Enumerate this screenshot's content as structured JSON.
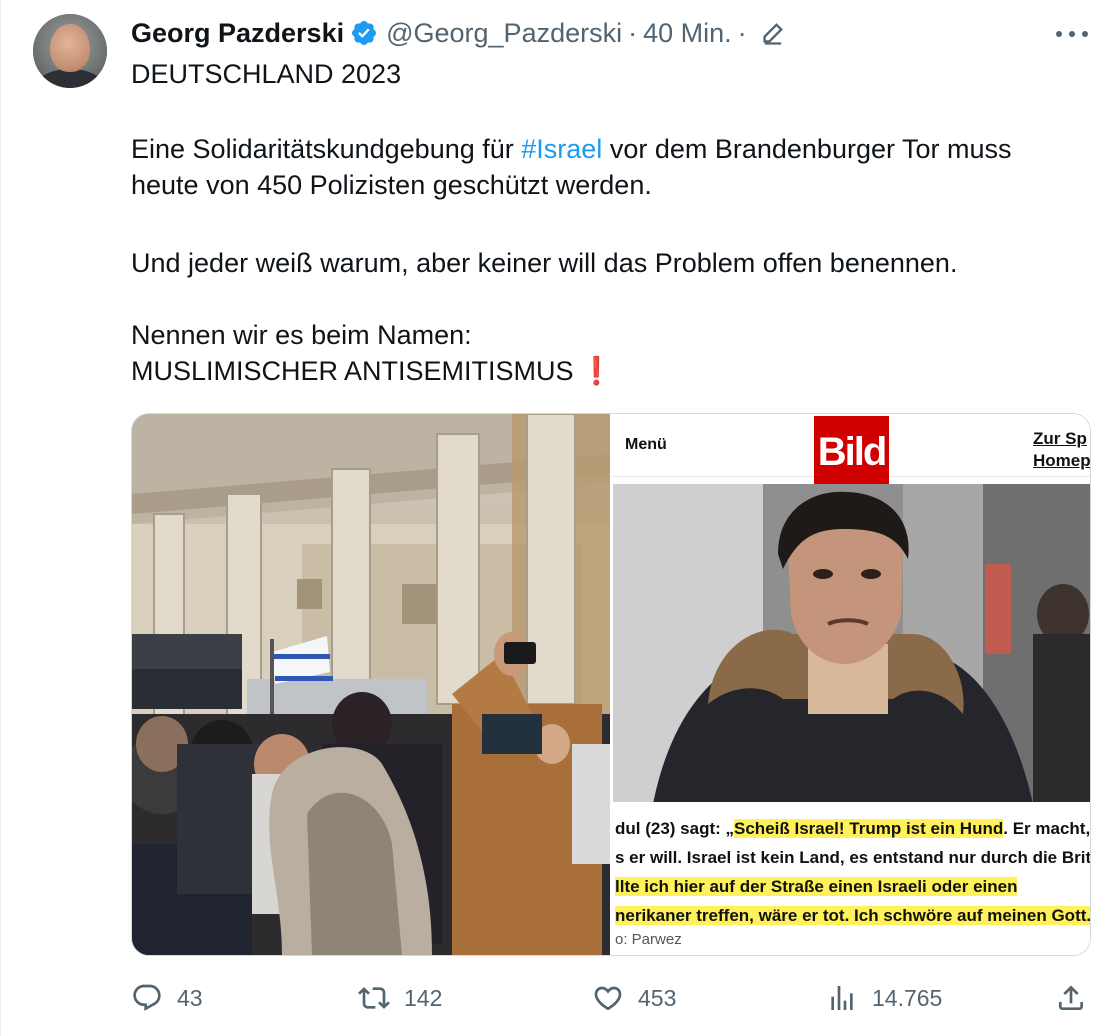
{
  "author": {
    "name": "Georg Pazderski",
    "handle": "@Georg_Pazderski",
    "separator": "·",
    "time": "40 Min.",
    "verified": true
  },
  "tweet": {
    "line1": "DEUTSCHLAND 2023",
    "para2_before": "Eine Solidaritätskundgebung für ",
    "hashtag": "#Israel",
    "para2_after": " vor dem Brandenburger Tor muss",
    "para2_line2": "heute von 450 Polizisten geschützt werden.",
    "para3": "Und jeder weiß warum, aber keiner will das Problem offen benennen.",
    "para4_line1": "Nennen wir es beim Namen:",
    "para4_line2": "MUSLIMISCHER ANTISEMITISMUS",
    "emoji": "❗"
  },
  "media": {
    "bild": {
      "menu": "Menü",
      "logo": "Bild",
      "link_line1": "Zur Sp",
      "link_line2": "Homep",
      "quote_line1_a": "dul (23) sagt: „",
      "quote_line1_b": "Scheiß Israel! Trump ist ein Hund",
      "quote_line1_c": ". Er macht,",
      "quote_line2": "s er will. Israel ist kein Land, es entstand nur durch die Brite",
      "quote_line3": "llte ich hier auf der Straße einen Israeli oder einen",
      "quote_line4": "nerikaner treffen, wäre er tot. Ich schwöre auf meinen Gott.“",
      "credit": "o: Parwez"
    }
  },
  "actions": {
    "replies": "43",
    "reposts": "142",
    "likes": "453",
    "views": "14.765"
  },
  "colors": {
    "accent": "#1d9bf0",
    "muted": "#536471",
    "bild_red": "#d00000",
    "highlight": "#fff15a"
  }
}
